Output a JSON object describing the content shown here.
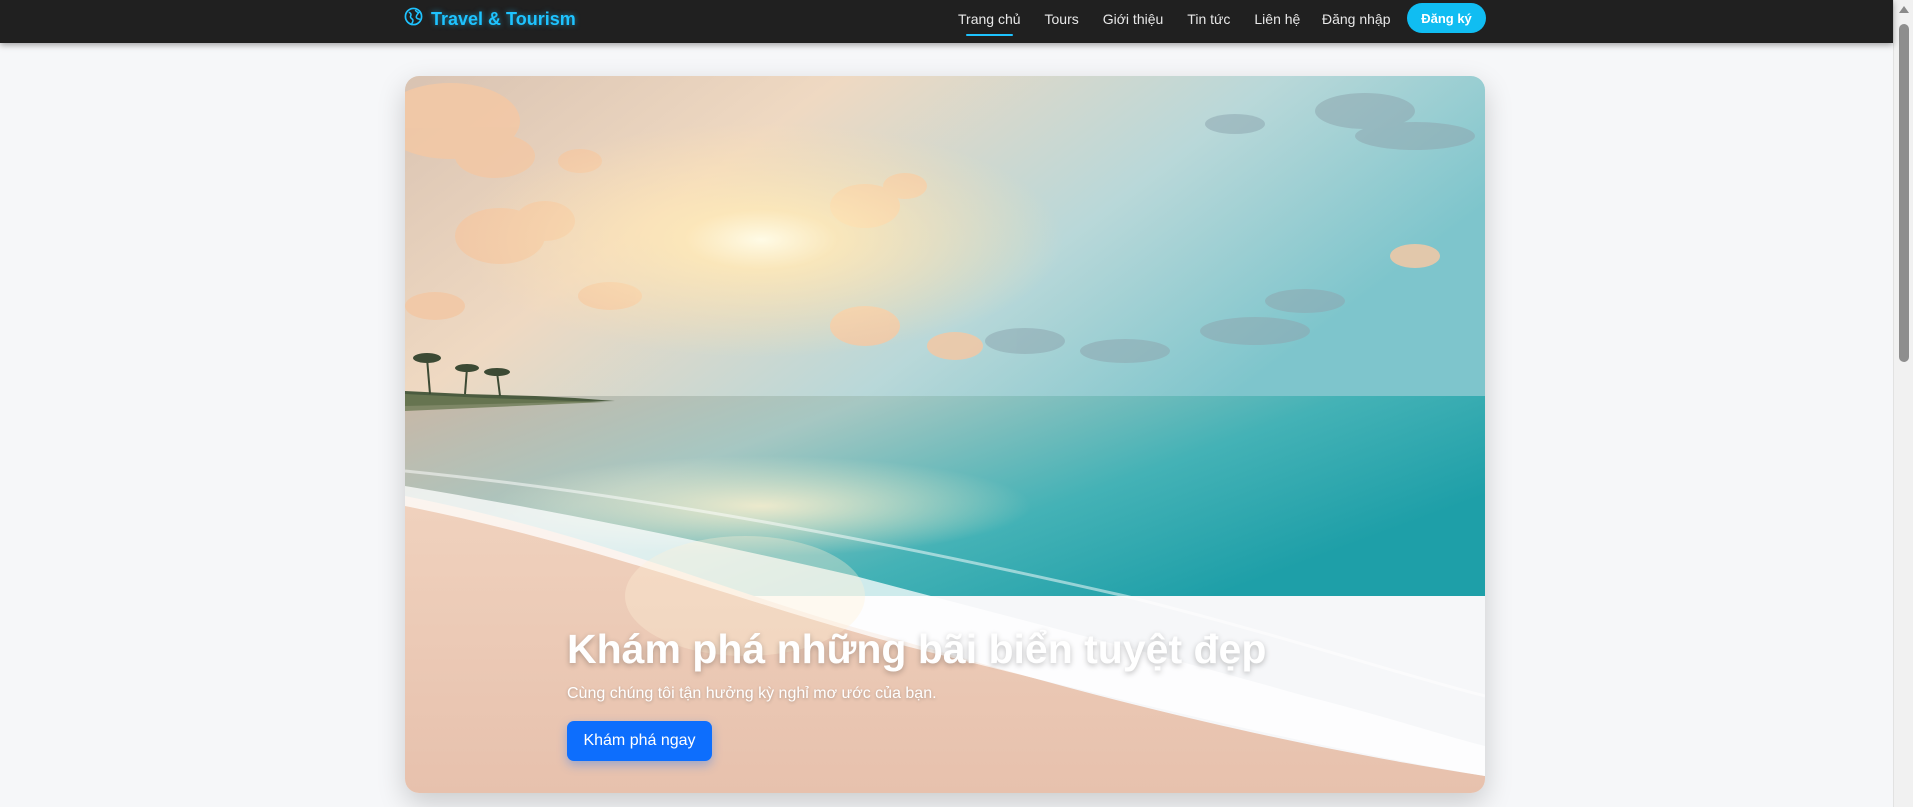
{
  "brand": {
    "name": "Travel & Tourism",
    "icon": "globe-icon",
    "color": "#1ec3ff"
  },
  "nav": {
    "links": [
      {
        "label": "Trang chủ",
        "active": true
      },
      {
        "label": "Tours",
        "active": false
      },
      {
        "label": "Giới thiệu",
        "active": false
      },
      {
        "label": "Tin tức",
        "active": false
      },
      {
        "label": "Liên hệ",
        "active": false
      }
    ],
    "login_label": "Đăng nhập",
    "signup_label": "Đăng ký"
  },
  "hero": {
    "title": "Khám phá những bãi biển tuyệt đẹp",
    "subtitle": "Cùng chúng tôi tận hưởng kỳ nghỉ mơ ước của bạn.",
    "cta_label": "Khám phá ngay",
    "cta_color": "#0d6efd"
  },
  "colors": {
    "navbar": "#202020",
    "accent": "#10bdf2",
    "background": "#f6f7f9"
  }
}
